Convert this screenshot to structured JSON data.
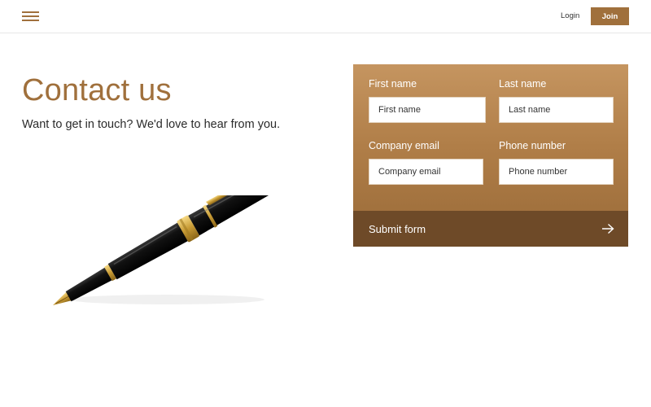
{
  "nav": {
    "menu_icon": "hamburger-menu-icon",
    "login_label": "Login",
    "join_label": "Join",
    "accent_color": "#a0703c"
  },
  "hero": {
    "title": "Contact us",
    "subtitle": "Want to get in touch? We'd love to hear from you.",
    "image": "fountain-pen-image"
  },
  "form": {
    "fields": [
      {
        "label": "First name",
        "placeholder": "First name"
      },
      {
        "label": "Last name",
        "placeholder": "Last name"
      },
      {
        "label": "Company email",
        "placeholder": "Company email"
      },
      {
        "label": "Phone number",
        "placeholder": "Phone number"
      }
    ],
    "submit_label": "Submit form",
    "submit_icon": "arrow-right-icon"
  }
}
